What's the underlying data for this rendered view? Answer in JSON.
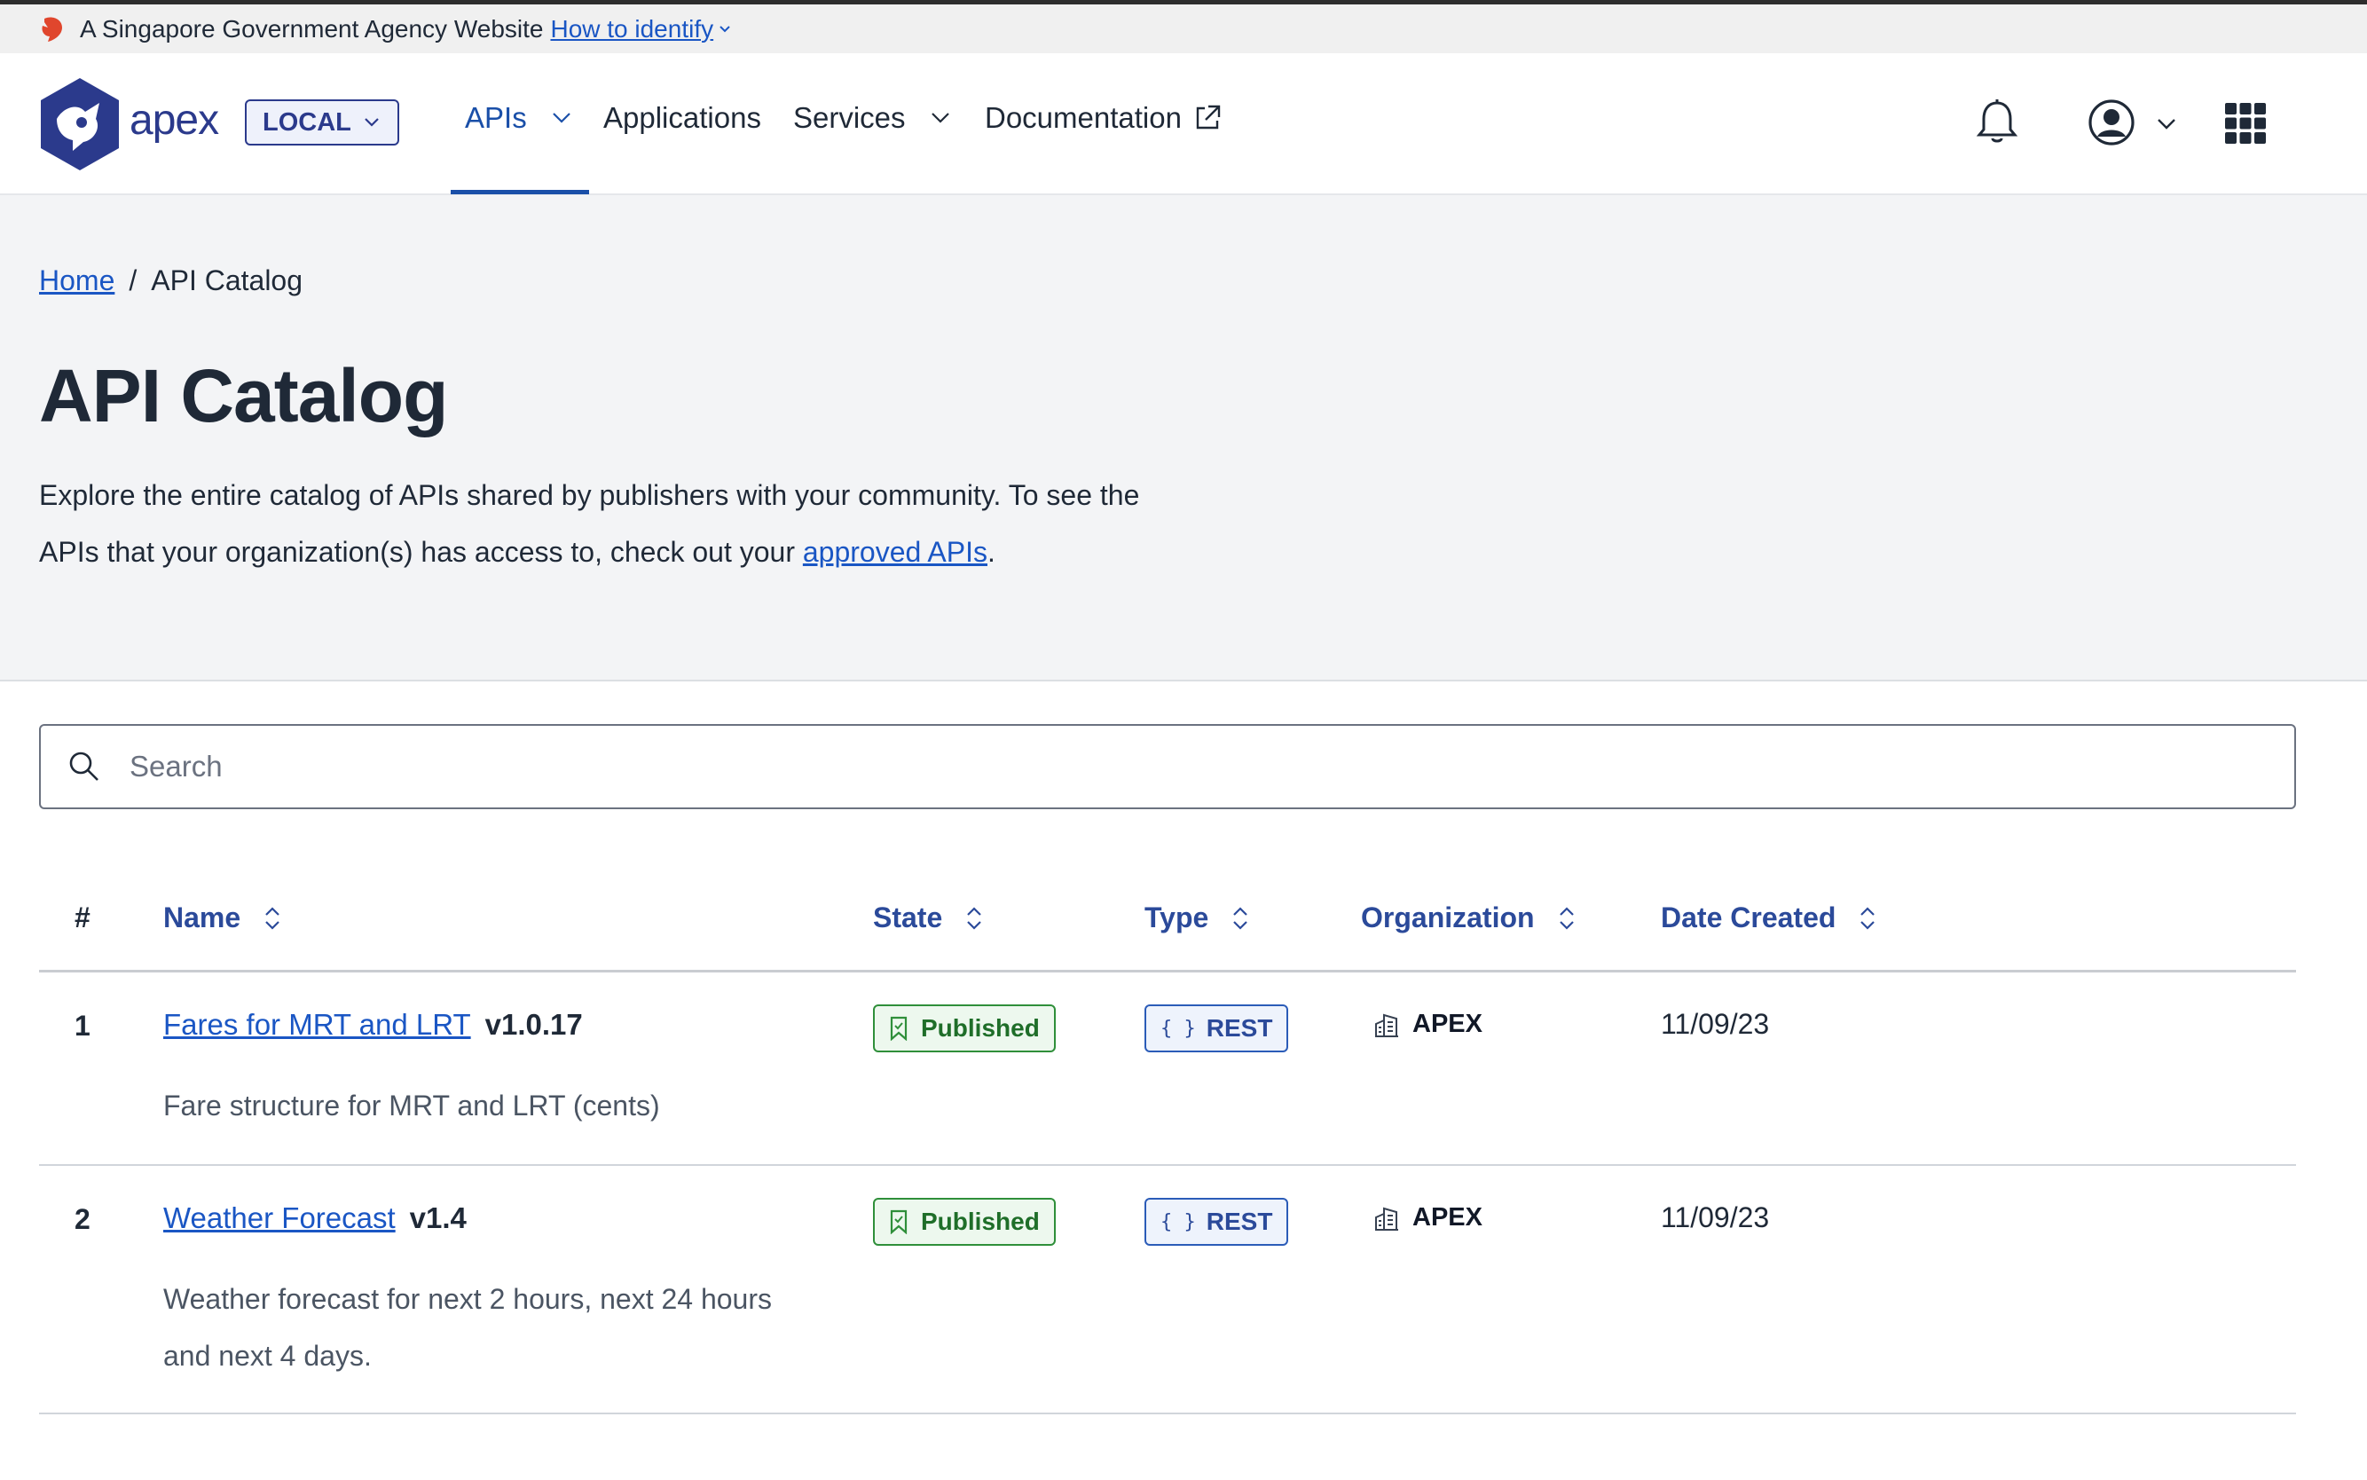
{
  "masthead": {
    "text": "A Singapore Government Agency Website",
    "link": "How to identify"
  },
  "navbar": {
    "logo_text": "apex",
    "environment": "LOCAL",
    "items": [
      {
        "label": "APIs"
      },
      {
        "label": "Applications"
      },
      {
        "label": "Services"
      },
      {
        "label": "Documentation"
      }
    ]
  },
  "breadcrumb": {
    "home": "Home",
    "separator": "/",
    "current": "API Catalog"
  },
  "page": {
    "title": "API Catalog",
    "intro_text": "Explore the entire catalog of APIs shared by publishers with your community. To see the APIs that your organization(s) has access to, check out your",
    "intro_link": "approved APIs",
    "intro_end": "."
  },
  "search": {
    "placeholder": "Search"
  },
  "table": {
    "columns": [
      "#",
      "Name",
      "State",
      "Type",
      "Organization",
      "Date Created"
    ],
    "rows": [
      {
        "num": "1",
        "name": "Fares for MRT and LRT",
        "version": "v1.0.17",
        "description": "Fare structure for MRT and LRT (cents)",
        "state": "Published",
        "type": "REST",
        "organization": "APEX",
        "date": "11/09/23"
      },
      {
        "num": "2",
        "name": "Weather Forecast",
        "version": "v1.4",
        "description": "Weather forecast for next 2 hours, next 24 hours and next 4 days.",
        "state": "Published",
        "type": "REST",
        "organization": "APEX",
        "date": "11/09/23"
      }
    ]
  },
  "colors": {
    "accent": "#1a4fa8",
    "link": "#1a56c4",
    "brand": "#2b3a8c",
    "published": "#2f8f3a",
    "hero_bg": "#f3f4f6"
  }
}
